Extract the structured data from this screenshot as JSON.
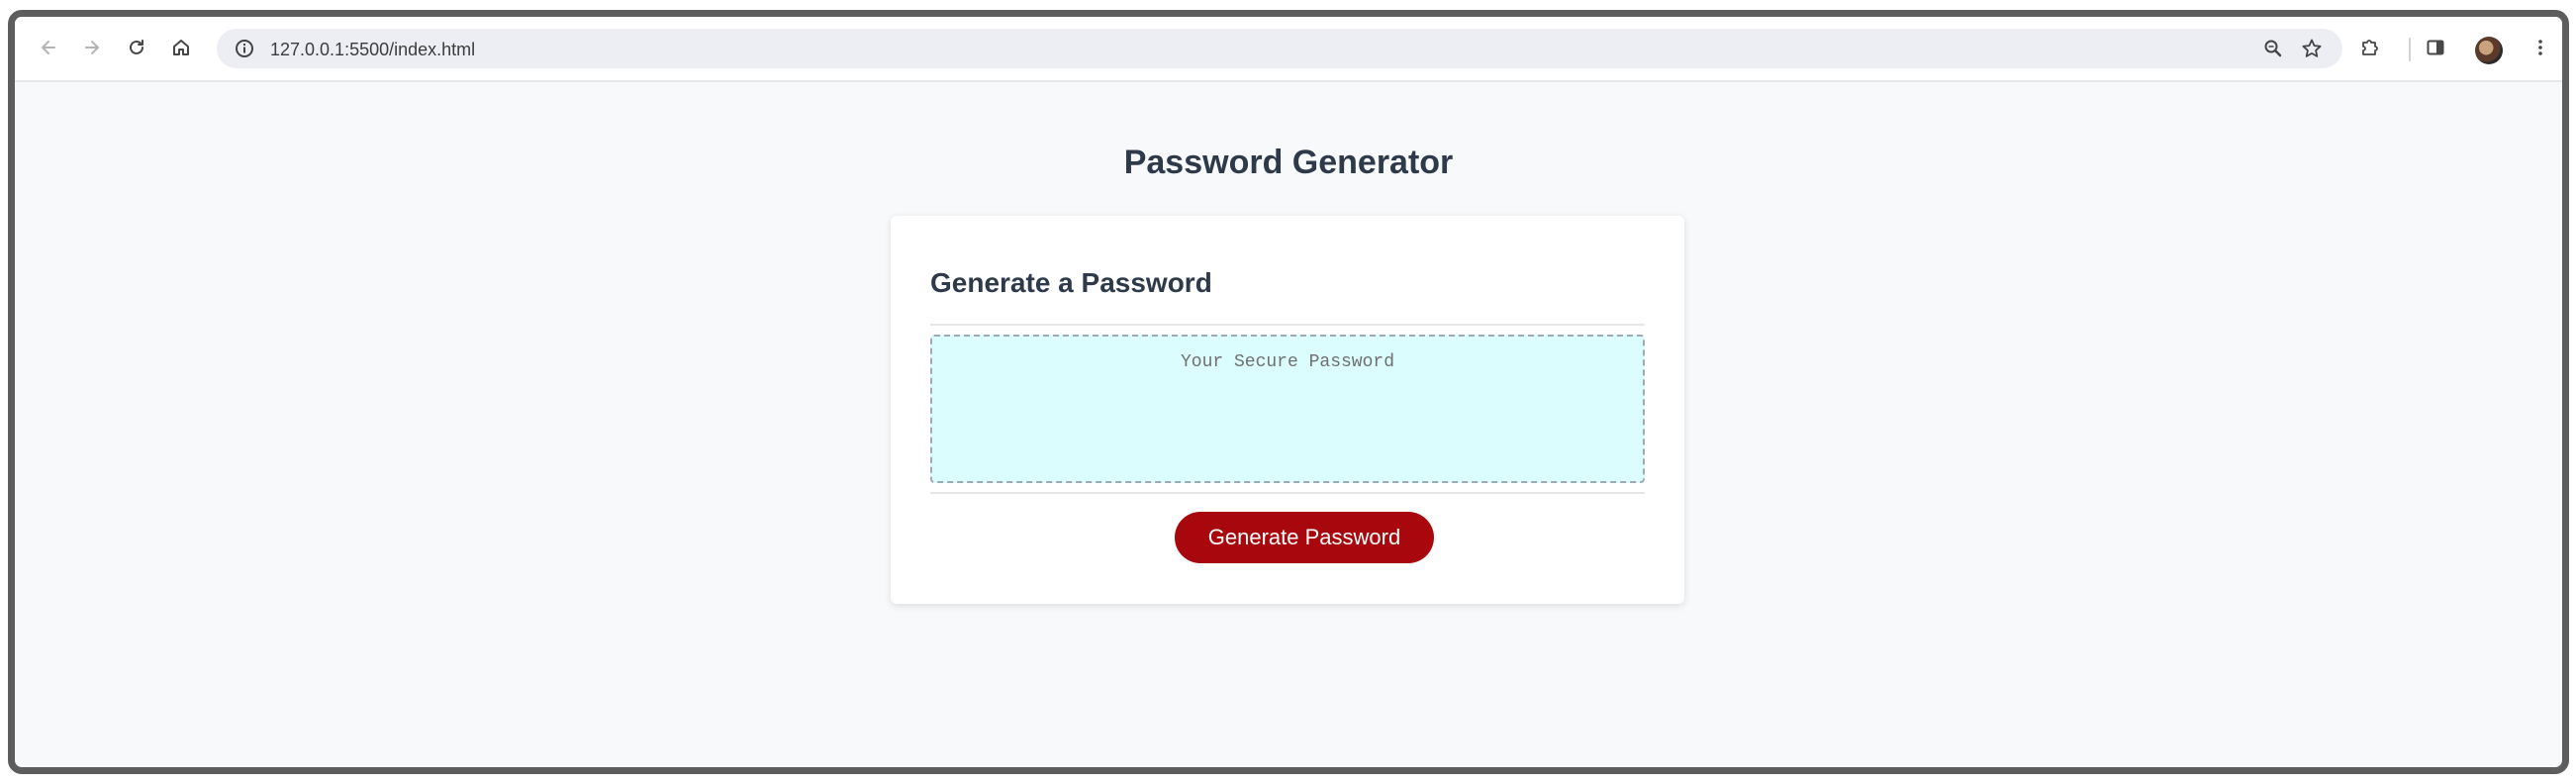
{
  "browser": {
    "url": "127.0.0.1:5500/index.html",
    "icons": {
      "back": "back-arrow-icon",
      "forward": "forward-arrow-icon",
      "reload": "reload-icon",
      "home": "home-icon",
      "info": "info-icon",
      "zoom": "zoom-icon",
      "bookmark": "star-icon",
      "extensions": "puzzle-icon",
      "side_panel": "side-panel-icon",
      "profile": "avatar",
      "menu": "kebab-menu-icon"
    }
  },
  "page": {
    "title": "Password Generator",
    "card": {
      "title": "Generate a Password",
      "password_placeholder": "Your Secure Password",
      "password_value": "",
      "button_label": "Generate Password"
    }
  },
  "colors": {
    "button_bg": "#a8080d",
    "textarea_bg": "#dcfdfd",
    "heading": "#2e3a4a",
    "page_bg": "#f8f9fb"
  }
}
